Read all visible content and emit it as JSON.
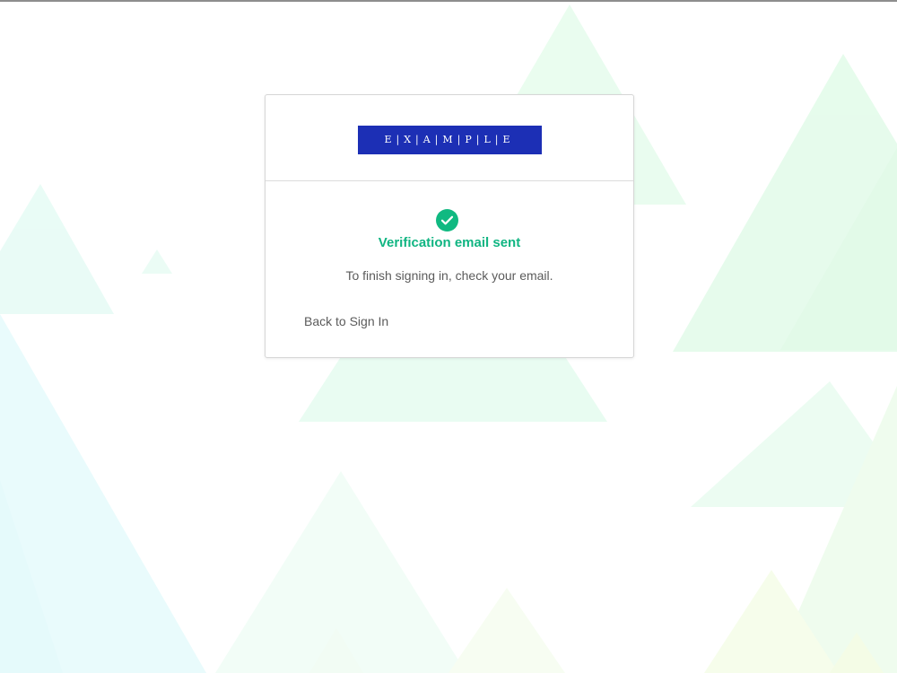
{
  "brand": {
    "logo_text": "E|X|A|M|P|L|E",
    "logo_color": "#1c2fb5"
  },
  "status": {
    "icon": "check-circle-icon",
    "title": "Verification email sent",
    "message": "To finish signing in, check your email.",
    "color": "#10b981"
  },
  "actions": {
    "back_label": "Back to Sign In"
  }
}
